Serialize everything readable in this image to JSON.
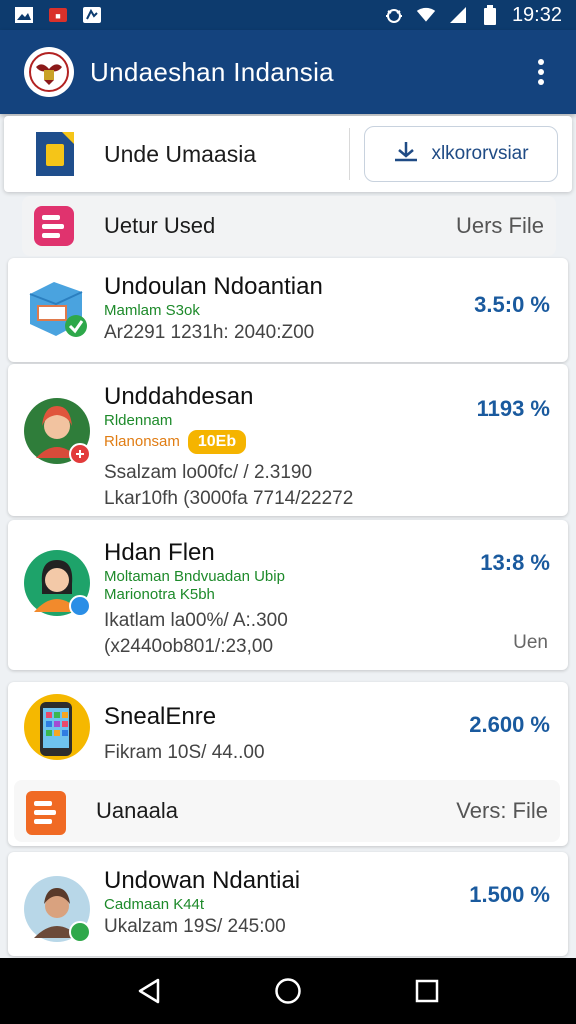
{
  "status_bar": {
    "time": "19:32",
    "icons": [
      "image-icon",
      "notification-icon",
      "app-icon",
      "bug-icon",
      "wifi-icon",
      "signal-icon",
      "battery-icon"
    ]
  },
  "app_bar": {
    "title": "Undaeshan Indansia",
    "logo_icon": "garuda-emblem-icon",
    "menu_icon": "more-vert-icon"
  },
  "header": {
    "label": "Unde Umaasia",
    "icon": "sim-card-icon",
    "action_label": "xlkororvsiar",
    "action_icon": "download-icon"
  },
  "sections": [
    {
      "title": "Uetur Used",
      "action": "Uers File",
      "icon": "list-icon"
    },
    {
      "title": "Uanaala",
      "action": "Vers: File",
      "icon": "list-icon"
    }
  ],
  "items": [
    {
      "title": "Undoulan Ndoantian",
      "subtitle": "Mamlam S3ok",
      "meta1": "Ar2291 1231h: 2040:Z00",
      "percent": "3.5:0 %",
      "icon": "package-check-icon"
    },
    {
      "title": "Unddahdesan",
      "subtitle": "Rldennam",
      "subtitle2": "Rlanonsam",
      "tag": "10Eb",
      "meta1": "Ssalzam lo00fc/ / 2.3190",
      "meta2": "Lkar10fh (3000fa 7714/22272",
      "percent": "1193 %",
      "icon": "avatar-woman-hijab-icon"
    },
    {
      "title": "Hdan Flen",
      "subtitle": "Moltaman Bndvuadan Ubip",
      "subtitle2": "Marionotra K5bh",
      "meta1": "Ikatlam la00%/ A:.300",
      "meta2": "(x2440ob801/:23,00",
      "percent": "13:8 %",
      "extra": "Uen",
      "icon": "avatar-woman-icon"
    },
    {
      "title": "SnealEnre",
      "meta1": "Fikram 10S/ 44..00",
      "percent": "2.600 %",
      "icon": "smartphone-icon"
    },
    {
      "title": "Undowan Ndantiai",
      "subtitle": "Cadmaan K44t",
      "meta1": "Ukalzam 19S/ 245:00",
      "percent": "1.500 %",
      "icon": "avatar-man-icon"
    }
  ],
  "nav": {
    "back_icon": "back-triangle-icon",
    "home_icon": "home-circle-icon",
    "recents_icon": "recents-square-icon"
  },
  "colors": {
    "primary": "#14437e",
    "status_bar": "#0d3b6e",
    "percent": "#1a5a9e",
    "subtitle_green": "#1d8a2a",
    "tag": "#f5b400"
  }
}
